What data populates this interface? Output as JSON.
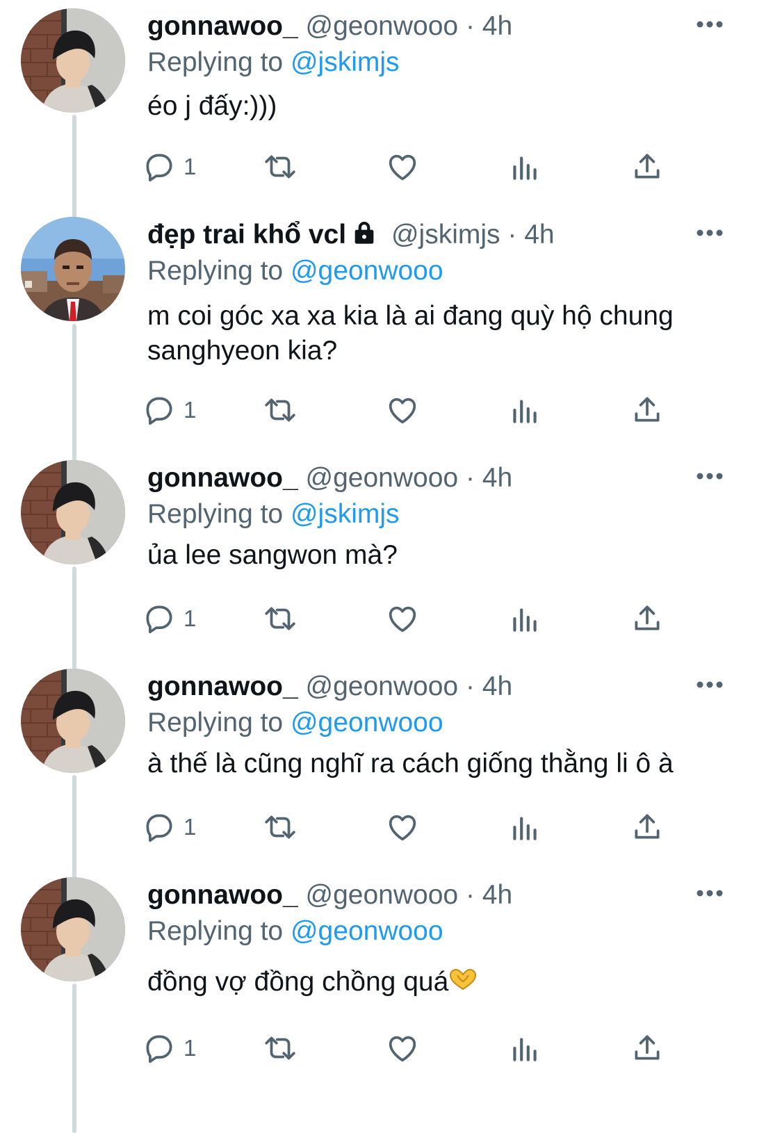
{
  "tweets": [
    {
      "display_name": "gonnawoo_",
      "handle": "@geonwooo",
      "separator": "·",
      "time": "4h",
      "replying_label": "Replying to",
      "replying_to": "@jskimjs",
      "text": "éo j đấy:)))",
      "reply_count": "1",
      "avatar": "gonnawoo-avatar",
      "locked": false
    },
    {
      "display_name": "đẹp trai khổ vcl",
      "handle": "@jskimjs",
      "separator": "·",
      "time": "4h",
      "replying_label": "Replying to",
      "replying_to": "@geonwooo",
      "text": "m coi góc xa xa kia là ai đang quỳ hộ chung sanghyeon kia?",
      "reply_count": "1",
      "avatar": "jskimjs-avatar",
      "locked": true
    },
    {
      "display_name": "gonnawoo_",
      "handle": "@geonwooo",
      "separator": "·",
      "time": "4h",
      "replying_label": "Replying to",
      "replying_to": "@jskimjs",
      "text": "ủa lee sangwon mà?",
      "reply_count": "1",
      "avatar": "gonnawoo-avatar",
      "locked": false
    },
    {
      "display_name": "gonnawoo_",
      "handle": "@geonwooo",
      "separator": "·",
      "time": "4h",
      "replying_label": "Replying to",
      "replying_to": "@geonwooo",
      "text": "à thế là cũng nghĩ ra cách giống thằng li ô à",
      "reply_count": "1",
      "avatar": "gonnawoo-avatar",
      "locked": false
    },
    {
      "display_name": "gonnawoo_",
      "handle": "@geonwooo",
      "separator": "·",
      "time": "4h",
      "replying_label": "Replying to",
      "replying_to": "@geonwooo",
      "text": "đồng vợ đồng chồng quá",
      "text_emoji": "heart-hands-emoji",
      "reply_count": "1",
      "avatar": "gonnawoo-avatar",
      "locked": false
    }
  ],
  "icons": {
    "reply": "reply-icon",
    "retweet": "retweet-icon",
    "like": "like-icon",
    "views": "views-icon",
    "share": "share-icon",
    "more": "more-icon",
    "lock": "lock-icon"
  },
  "colors": {
    "text": "#0f1419",
    "secondary": "#536471",
    "mention": "#1d9bf0",
    "thread_line": "#cfd9de",
    "background": "#ffffff"
  }
}
